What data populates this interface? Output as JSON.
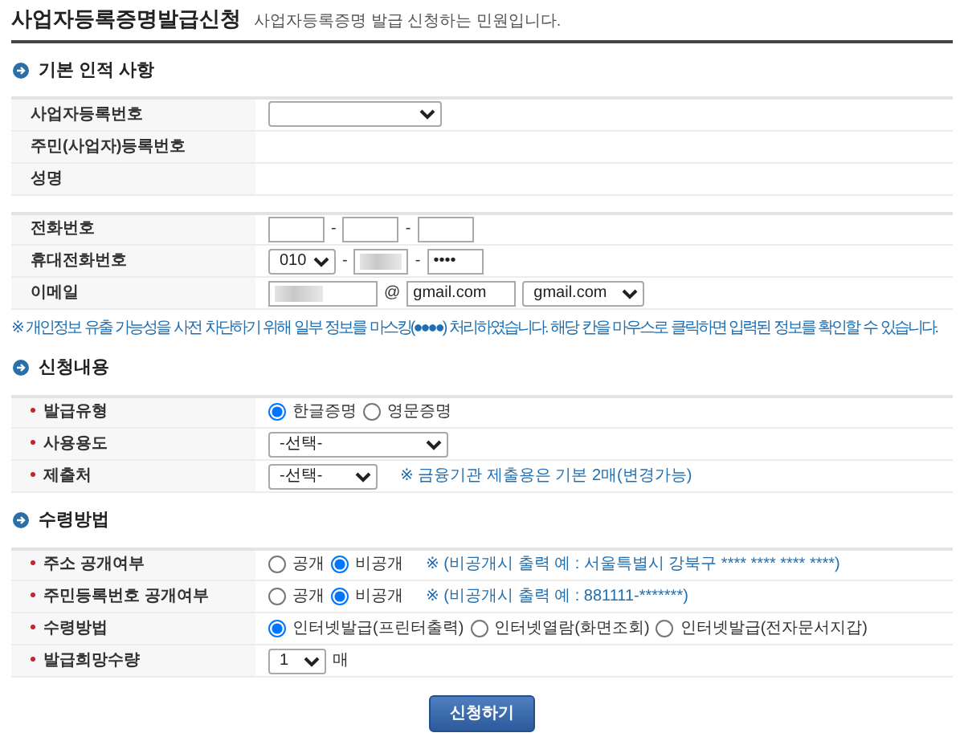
{
  "header": {
    "title": "사업자등록증명발급신청",
    "subtitle": "사업자등록증명 발급 신청하는 민원입니다."
  },
  "sections": [
    {
      "title": "기본 인적 사항",
      "tables": [
        [
          {
            "label": "사업자등록번호",
            "required": false,
            "kind": "id-select",
            "controls": [
              {
                "kind": "select"
              }
            ]
          },
          {
            "label": "주민(사업자)등록번호",
            "required": false,
            "kind": "text"
          },
          {
            "label": "성명",
            "required": false,
            "kind": "text"
          }
        ],
        [
          {
            "label": "전화번호",
            "required": false,
            "kind": "phone",
            "controls": [
              {
                "kind": "input"
              },
              {
                "kind": "sep",
                "text": "-"
              },
              {
                "kind": "input"
              },
              {
                "kind": "sep",
                "text": "-"
              },
              {
                "kind": "input"
              }
            ]
          },
          {
            "label": "휴대전화번호",
            "required": false,
            "kind": "mobile",
            "controls": [
              {
                "kind": "select",
                "value": "010"
              },
              {
                "kind": "sep",
                "text": "-"
              },
              {
                "kind": "input",
                "masked": true
              },
              {
                "kind": "sep",
                "text": "-"
              },
              {
                "kind": "input",
                "value": "••••"
              }
            ]
          },
          {
            "label": "이메일",
            "required": false,
            "kind": "email",
            "controls": [
              {
                "kind": "input",
                "masked": true
              },
              {
                "kind": "sep",
                "text": "@"
              },
              {
                "kind": "input",
                "value": "gmail.com"
              },
              {
                "kind": "select",
                "value": "gmail.com"
              }
            ]
          }
        ]
      ],
      "note": "※ 개인정보 유출 가능성을 사전 차단하기 위해 일부 정보를 마스킹(●●●●) 처리하였습니다. 해당 칸을 마우스로 클릭하면 입력된 정보를 확인할 수 있습니다."
    },
    {
      "title": "신청내용",
      "tables": [
        [
          {
            "label": "발급유형",
            "required": true,
            "kind": "radios",
            "controls": [
              {
                "kind": "radio",
                "text": "한글증명",
                "selected": true
              },
              {
                "kind": "radio",
                "text": "영문증명",
                "selected": false
              }
            ]
          },
          {
            "label": "사용용도",
            "required": true,
            "kind": "select",
            "controls": [
              {
                "kind": "select",
                "value": "-선택-"
              }
            ]
          },
          {
            "label": "제출처",
            "required": true,
            "kind": "select-note",
            "controls": [
              {
                "kind": "select",
                "value": "-선택-"
              },
              {
                "kind": "note",
                "text": "※ 금융기관 제출용은 기본 2매(변경가능)"
              }
            ]
          }
        ]
      ]
    },
    {
      "title": "수령방법",
      "tables": [
        [
          {
            "label": "주소 공개여부",
            "required": true,
            "kind": "radios",
            "controls": [
              {
                "kind": "radio",
                "text": "공개",
                "selected": false
              },
              {
                "kind": "radio",
                "text": "비공개",
                "selected": true
              },
              {
                "kind": "note",
                "text": "※ (비공개시 출력 예 : 서울특별시 강북구 **** **** **** ****)"
              }
            ]
          },
          {
            "label": "주민등록번호 공개여부",
            "required": true,
            "kind": "radios",
            "controls": [
              {
                "kind": "radio",
                "text": "공개",
                "selected": false
              },
              {
                "kind": "radio",
                "text": "비공개",
                "selected": true
              },
              {
                "kind": "note",
                "text": "※ (비공개시 출력 예 : 881111-*******)"
              }
            ]
          },
          {
            "label": "수령방법",
            "required": true,
            "kind": "radios",
            "controls": [
              {
                "kind": "radio",
                "text": "인터넷발급(프린터출력)",
                "selected": true
              },
              {
                "kind": "radio",
                "text": "인터넷열람(화면조회)",
                "selected": false
              },
              {
                "kind": "radio",
                "text": "인터넷발급(전자문서지갑)",
                "selected": false
              }
            ]
          },
          {
            "label": "발급희망수량",
            "required": true,
            "kind": "count",
            "controls": [
              {
                "kind": "select",
                "value": "1"
              },
              {
                "kind": "unit",
                "text": "매"
              }
            ]
          }
        ]
      ]
    }
  ],
  "submit": "신청하기"
}
